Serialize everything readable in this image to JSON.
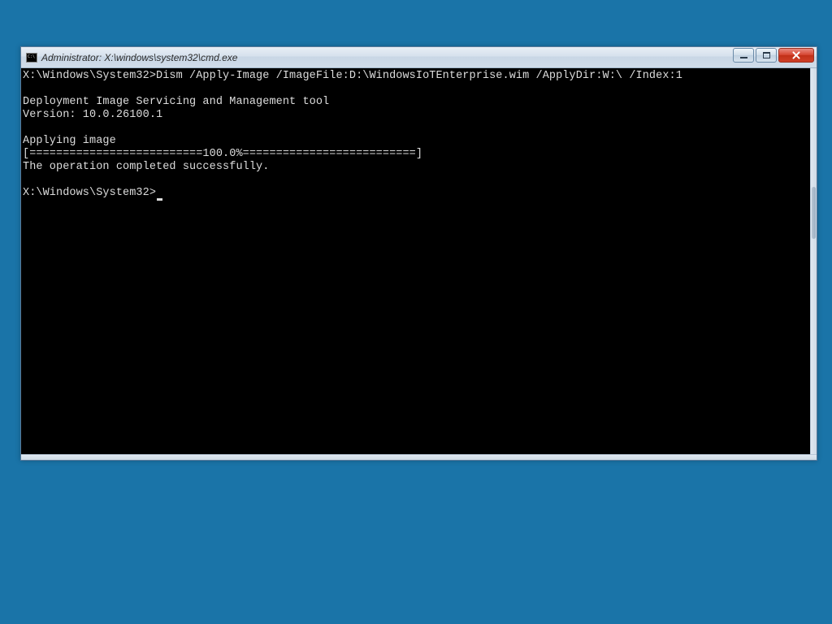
{
  "window": {
    "title": "Administrator: X:\\windows\\system32\\cmd.exe"
  },
  "terminal": {
    "lines": [
      "X:\\Windows\\System32>Dism /Apply-Image /ImageFile:D:\\WindowsIoTEnterprise.wim /ApplyDir:W:\\ /Index:1",
      "",
      "Deployment Image Servicing and Management tool",
      "Version: 10.0.26100.1",
      "",
      "Applying image",
      "[==========================100.0%==========================]",
      "The operation completed successfully.",
      "",
      "X:\\Windows\\System32>"
    ],
    "cursor_line_index": 9
  }
}
